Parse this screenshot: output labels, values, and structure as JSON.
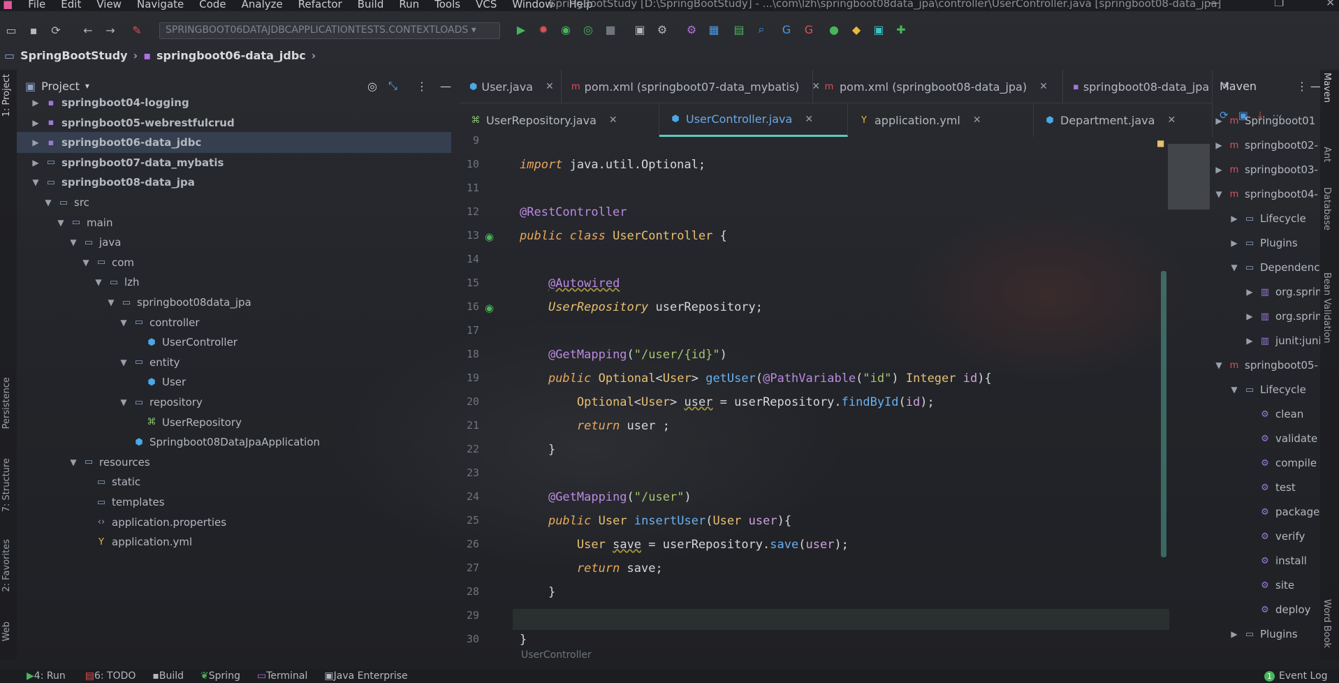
{
  "menu": {
    "items": [
      "File",
      "Edit",
      "View",
      "Navigate",
      "Code",
      "Analyze",
      "Refactor",
      "Build",
      "Run",
      "Tools",
      "VCS",
      "Window",
      "Help"
    ],
    "title": "SpringBootStudy [D:\\SpringBootStudy] - ...\\com\\lzh\\springboot08data_jpa\\controller\\UserController.java [springboot08-data_jpa]"
  },
  "toolbar": {
    "run_config": "SPRINGBOOT06DATAJDBCAPPLICATIONTESTS.CONTEXTLOADS"
  },
  "breadcrumb": [
    "SpringBootStudy",
    "springboot06-data_jdbc"
  ],
  "project": {
    "title": "Project",
    "items": [
      {
        "label": "springboot04-logging",
        "depth": 1,
        "arrow": "▶",
        "icon": "module",
        "bold": true
      },
      {
        "label": "springboot05-webrestfulcrud",
        "depth": 1,
        "arrow": "▶",
        "icon": "module",
        "bold": true
      },
      {
        "label": "springboot06-data_jdbc",
        "depth": 1,
        "arrow": "▶",
        "icon": "module",
        "bold": true,
        "selected": true
      },
      {
        "label": "springboot07-data_mybatis",
        "depth": 1,
        "arrow": "▶",
        "icon": "folder",
        "bold": true
      },
      {
        "label": "springboot08-data_jpa",
        "depth": 1,
        "arrow": "▼",
        "icon": "folder",
        "bold": true
      },
      {
        "label": "src",
        "depth": 2,
        "arrow": "▼",
        "icon": "folder"
      },
      {
        "label": "main",
        "depth": 3,
        "arrow": "▼",
        "icon": "folder"
      },
      {
        "label": "java",
        "depth": 4,
        "arrow": "▼",
        "icon": "folder"
      },
      {
        "label": "com",
        "depth": 5,
        "arrow": "▼",
        "icon": "folder"
      },
      {
        "label": "lzh",
        "depth": 6,
        "arrow": "▼",
        "icon": "folder"
      },
      {
        "label": "springboot08data_jpa",
        "depth": 7,
        "arrow": "▼",
        "icon": "folder"
      },
      {
        "label": "controller",
        "depth": 8,
        "arrow": "▼",
        "icon": "folder"
      },
      {
        "label": "UserController",
        "depth": 9,
        "arrow": "",
        "icon": "class"
      },
      {
        "label": "entity",
        "depth": 8,
        "arrow": "▼",
        "icon": "folder"
      },
      {
        "label": "User",
        "depth": 9,
        "arrow": "",
        "icon": "class"
      },
      {
        "label": "repository",
        "depth": 8,
        "arrow": "▼",
        "icon": "folder"
      },
      {
        "label": "UserRepository",
        "depth": 9,
        "arrow": "",
        "icon": "interface"
      },
      {
        "label": "Springboot08DataJpaApplication",
        "depth": 8,
        "arrow": "",
        "icon": "class"
      },
      {
        "label": "resources",
        "depth": 4,
        "arrow": "▼",
        "icon": "folder"
      },
      {
        "label": "static",
        "depth": 5,
        "arrow": "",
        "icon": "folder"
      },
      {
        "label": "templates",
        "depth": 5,
        "arrow": "",
        "icon": "folder"
      },
      {
        "label": "application.properties",
        "depth": 5,
        "arrow": "",
        "icon": "props"
      },
      {
        "label": "application.yml",
        "depth": 5,
        "arrow": "",
        "icon": "yml"
      }
    ]
  },
  "tabs_row1": [
    {
      "label": "User.java",
      "icon": "class"
    },
    {
      "label": "pom.xml (springboot07-data_mybatis)",
      "icon": "maven"
    },
    {
      "label": "pom.xml (springboot08-data_jpa)",
      "icon": "maven"
    },
    {
      "label": "springboot08-data_jpa",
      "icon": "module"
    }
  ],
  "tabs_row2": [
    {
      "label": "UserRepository.java",
      "icon": "interface"
    },
    {
      "label": "UserController.java",
      "icon": "class",
      "active": true
    },
    {
      "label": "application.yml",
      "icon": "yml"
    },
    {
      "label": "Department.java",
      "icon": "class"
    }
  ],
  "editor": {
    "line_numbers": [
      "9",
      "10",
      "11",
      "12",
      "13",
      "14",
      "15",
      "16",
      "17",
      "18",
      "19",
      "20",
      "21",
      "22",
      "23",
      "24",
      "25",
      "26",
      "27",
      "28",
      "29",
      "30"
    ],
    "footer_breadcrumb": "UserController"
  },
  "maven": {
    "title": "Maven",
    "items": [
      {
        "label": "Springboot01",
        "depth": 0,
        "arrow": "▶",
        "icon": "maven"
      },
      {
        "label": "springboot02-",
        "depth": 0,
        "arrow": "▶",
        "icon": "maven"
      },
      {
        "label": "springboot03-",
        "depth": 0,
        "arrow": "▶",
        "icon": "maven"
      },
      {
        "label": "springboot04-",
        "depth": 0,
        "arrow": "▼",
        "icon": "maven"
      },
      {
        "label": "Lifecycle",
        "depth": 1,
        "arrow": "▶",
        "icon": "folder"
      },
      {
        "label": "Plugins",
        "depth": 1,
        "arrow": "▶",
        "icon": "folder"
      },
      {
        "label": "Dependenc",
        "depth": 1,
        "arrow": "▼",
        "icon": "folder"
      },
      {
        "label": "org.sprin",
        "depth": 2,
        "arrow": "▶",
        "icon": "lib"
      },
      {
        "label": "org.sprin",
        "depth": 2,
        "arrow": "▶",
        "icon": "lib"
      },
      {
        "label": "junit:juni",
        "depth": 2,
        "arrow": "▶",
        "icon": "lib"
      },
      {
        "label": "springboot05-",
        "depth": 0,
        "arrow": "▼",
        "icon": "maven"
      },
      {
        "label": "Lifecycle",
        "depth": 1,
        "arrow": "▼",
        "icon": "folder"
      },
      {
        "label": "clean",
        "depth": 2,
        "arrow": "",
        "icon": "goal"
      },
      {
        "label": "validate",
        "depth": 2,
        "arrow": "",
        "icon": "goal"
      },
      {
        "label": "compile",
        "depth": 2,
        "arrow": "",
        "icon": "goal"
      },
      {
        "label": "test",
        "depth": 2,
        "arrow": "",
        "icon": "goal"
      },
      {
        "label": "package",
        "depth": 2,
        "arrow": "",
        "icon": "goal"
      },
      {
        "label": "verify",
        "depth": 2,
        "arrow": "",
        "icon": "goal"
      },
      {
        "label": "install",
        "depth": 2,
        "arrow": "",
        "icon": "goal"
      },
      {
        "label": "site",
        "depth": 2,
        "arrow": "",
        "icon": "goal"
      },
      {
        "label": "deploy",
        "depth": 2,
        "arrow": "",
        "icon": "goal"
      },
      {
        "label": "Plugins",
        "depth": 1,
        "arrow": "▶",
        "icon": "folder"
      }
    ]
  },
  "left_tool_tabs": [
    "1: Project",
    "Persistence",
    "7: Structure",
    "2: Favorites",
    "Web"
  ],
  "right_tool_tabs": [
    "Maven",
    "Ant",
    "Database",
    "Bean Validation",
    "Word Book"
  ],
  "statusbar": {
    "items": [
      "4: Run",
      "6: TODO",
      "Build",
      "Spring",
      "Terminal",
      "Java Enterprise"
    ],
    "event_log": "Event Log",
    "event_count": "1"
  }
}
